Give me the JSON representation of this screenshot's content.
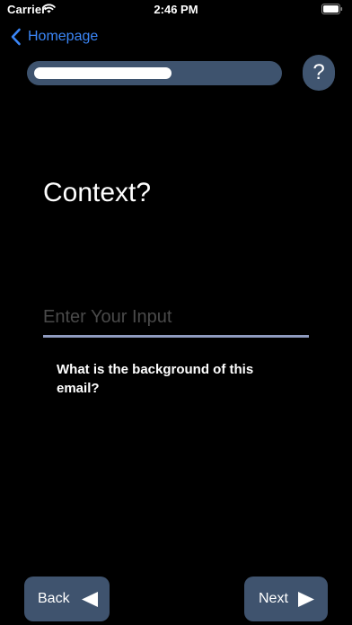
{
  "status_bar": {
    "carrier": "Carrier",
    "time": "2:46 PM"
  },
  "nav": {
    "back_label": "Homepage"
  },
  "progress": {
    "fraction": 0.57
  },
  "help_button": {
    "label": "?"
  },
  "question": {
    "title": "Context?",
    "input_placeholder": "Enter Your Input",
    "input_value": "",
    "hint": "What is the background of this email?"
  },
  "footer": {
    "back_label": "Back",
    "next_label": "Next"
  },
  "colors": {
    "background": "#000000",
    "accent_blue": "#3b86f7",
    "control_fill": "#3f536e",
    "underline": "#8f9bbf"
  },
  "icons": {
    "back_nav": "chevron-left-icon",
    "back_button": "triangle-left-icon",
    "next_button": "triangle-right-icon",
    "wifi": "wifi-icon",
    "battery": "battery-icon"
  }
}
